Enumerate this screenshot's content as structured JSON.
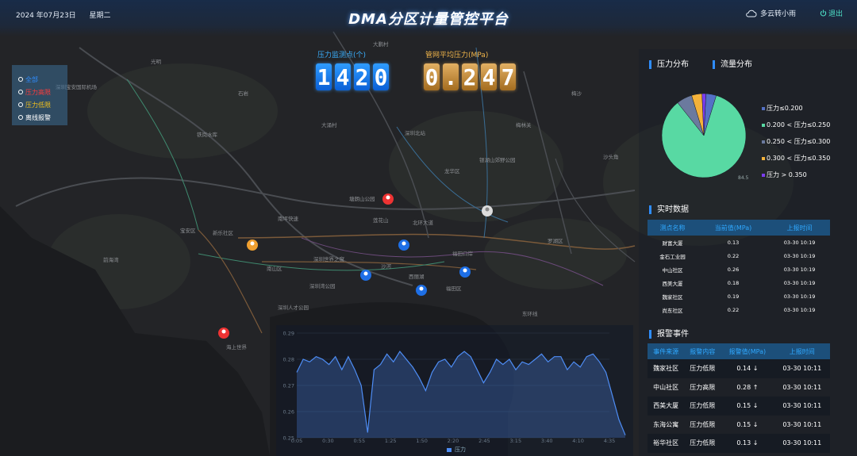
{
  "header": {
    "date": "2024 年07月23日",
    "weekday": "星期二",
    "title": "DMA分区计量管控平台",
    "weather": "多云转小雨",
    "exit_label": "退出"
  },
  "map": {
    "place_labels": [
      "深圳宝安国际机场",
      "铁岗水库",
      "大涌村",
      "深圳北站",
      "银湖山郊野公园",
      "龙华区",
      "南坪快速",
      "北环大道",
      "深圳世界之窗",
      "西丽湖",
      "福田区",
      "深圳湾公园",
      "罗湖区",
      "东环线",
      "南山区",
      "宝安区",
      "福田口岸",
      "沙河",
      "石岩",
      "光明",
      "大鹏村",
      "梅林关",
      "莲花山",
      "塘朗山公园",
      "海上世界",
      "深圳人才公园",
      "新乐社区",
      "前海湾",
      "梅沙",
      "沙头角"
    ],
    "legend": [
      {
        "label": "全部",
        "color": "#2f8dff"
      },
      {
        "label": "压力高限",
        "color": "#ff3b3b"
      },
      {
        "label": "压力低限",
        "color": "#f4c21c"
      },
      {
        "label": "离线报警",
        "color": "#ffffff"
      }
    ]
  },
  "counters": {
    "monitor_label": "压力监测点(个)",
    "monitor_digits": [
      "1",
      "4",
      "2",
      "0"
    ],
    "avg_label": "管网平均压力(MPa)",
    "avg_digits": [
      "0",
      ".",
      "2",
      "4",
      "7"
    ]
  },
  "pressure_distribution": {
    "tab_pressure": "压力分布",
    "tab_flow": "流量分布",
    "chart_data": {
      "type": "pie",
      "labels": [
        "压力≤0.200",
        "0.200 < 压力≤0.250",
        "0.250 < 压力≤0.300",
        "0.300 < 压力≤0.350",
        "压力 > 0.350"
      ],
      "values": [
        4,
        84.5,
        6,
        4,
        1.5
      ],
      "colors": [
        "#5470c6",
        "#58d9a3",
        "#6b7a9e",
        "#f4b23a",
        "#7b3cf0"
      ],
      "slice_label": "84.51%"
    }
  },
  "realtime": {
    "title": "实时数据",
    "columns": [
      "测点名称",
      "当前值(MPa)",
      "上报时间"
    ],
    "rows": [
      [
        "财富大厦",
        "0.13",
        "03-30 10:19"
      ],
      [
        "金石工业园",
        "0.22",
        "03-30 10:19"
      ],
      [
        "中山社区",
        "0.26",
        "03-30 10:19"
      ],
      [
        "西美大厦",
        "0.18",
        "03-30 10:19"
      ],
      [
        "魏家社区",
        "0.19",
        "03-30 10:19"
      ],
      [
        "尚东社区",
        "0.22",
        "03-30 10:19"
      ]
    ]
  },
  "alarms": {
    "title": "报警事件",
    "columns": [
      "事件来源",
      "报警内容",
      "报警值(MPa)",
      "上报时间"
    ],
    "rows": [
      {
        "source": "魏家社区",
        "content": "压力低限",
        "value": "0.14 ↓",
        "level": "warn",
        "time": "03-30 10:11"
      },
      {
        "source": "中山社区",
        "content": "压力高限",
        "value": "0.28 ↑",
        "level": "alarm",
        "time": "03-30 10:11"
      },
      {
        "source": "西美大厦",
        "content": "压力低限",
        "value": "0.15 ↓",
        "level": "warn",
        "time": "03-30 10:11"
      },
      {
        "source": "东海公寓",
        "content": "压力低限",
        "value": "0.15 ↓",
        "level": "warn",
        "time": "03-30 10:11"
      },
      {
        "source": "裕华社区",
        "content": "压力低限",
        "value": "0.13 ↓",
        "level": "warn",
        "time": "03-30 10:11"
      }
    ]
  },
  "trend_chart": {
    "legend_label": "压力",
    "chart_data": {
      "type": "area",
      "x": [
        "0:05",
        "0:30",
        "0:55",
        "1:25",
        "1:50",
        "2:20",
        "2:45",
        "3:15",
        "3:40",
        "4:10",
        "4:35"
      ],
      "y_ticks": [
        0.25,
        0.26,
        0.27,
        0.28,
        0.29
      ],
      "ylim": [
        0.25,
        0.29
      ],
      "series": [
        {
          "name": "压力",
          "color": "#4e8df5",
          "values": [
            0.275,
            0.28,
            0.279,
            0.281,
            0.28,
            0.278,
            0.281,
            0.276,
            0.281,
            0.276,
            0.27,
            0.252,
            0.276,
            0.278,
            0.282,
            0.279,
            0.283,
            0.28,
            0.277,
            0.273,
            0.268,
            0.275,
            0.279,
            0.28,
            0.277,
            0.281,
            0.283,
            0.281,
            0.276,
            0.271,
            0.275,
            0.28,
            0.278,
            0.28,
            0.276,
            0.279,
            0.278,
            0.28,
            0.282,
            0.279,
            0.281,
            0.281,
            0.276,
            0.279,
            0.277,
            0.281,
            0.282,
            0.279,
            0.275,
            0.266,
            0.257,
            0.251
          ]
        }
      ]
    }
  }
}
